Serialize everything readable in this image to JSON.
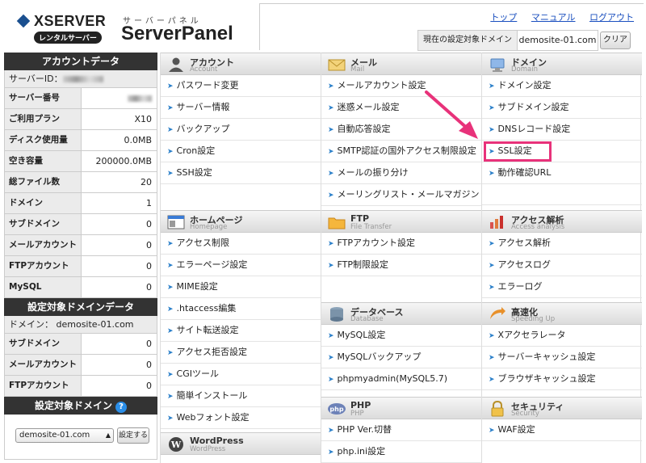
{
  "header": {
    "brand": "XSERVER",
    "tag": "レンタルサーバー",
    "kana": "サーバーパネル",
    "title": "ServerPanel",
    "links": [
      "トップ",
      "マニュアル",
      "ログアウト"
    ],
    "target_label": "現在の設定対象ドメイン",
    "target_value": "demosite-01.com",
    "clear_label": "クリア"
  },
  "sidebar": {
    "account_heading": "アカウントデータ",
    "server_id_label": "サーバーID：",
    "rows": [
      {
        "k": "サーバー番号",
        "v": ""
      },
      {
        "k": "ご利用プラン",
        "v": "X10"
      },
      {
        "k": "ディスク使用量",
        "v": "0.0MB"
      },
      {
        "k": "空き容量",
        "v": "200000.0MB"
      },
      {
        "k": "総ファイル数",
        "v": "20"
      },
      {
        "k": "ドメイン",
        "v": "1"
      },
      {
        "k": "サブドメイン",
        "v": "0"
      },
      {
        "k": "メールアカウント",
        "v": "0"
      },
      {
        "k": "FTPアカウント",
        "v": "0"
      },
      {
        "k": "MySQL",
        "v": "0"
      }
    ],
    "domain_heading": "設定対象ドメインデータ",
    "domain_line": "ドメイン： demosite-01.com",
    "domain_rows": [
      {
        "k": "サブドメイン",
        "v": "0"
      },
      {
        "k": "メールアカウント",
        "v": "0"
      },
      {
        "k": "FTPアカウント",
        "v": "0"
      }
    ],
    "select_heading": "設定対象ドメイン",
    "select_value": "demosite-01.com",
    "set_button": "設定する"
  },
  "sections": {
    "account": {
      "t1": "アカウント",
      "t2": "Account",
      "items": [
        "パスワード変更",
        "サーバー情報",
        "バックアップ",
        "Cron設定",
        "SSH設定"
      ]
    },
    "homepage": {
      "t1": "ホームページ",
      "t2": "Homepage",
      "items": [
        "アクセス制限",
        "エラーページ設定",
        "MIME設定",
        ".htaccess編集",
        "サイト転送設定",
        "アクセス拒否設定",
        "CGIツール",
        "簡単インストール",
        "Webフォント設定"
      ]
    },
    "wordpress": {
      "t1": "WordPress",
      "t2": "WordPress"
    },
    "mail": {
      "t1": "メール",
      "t2": "Mail",
      "items": [
        "メールアカウント設定",
        "迷惑メール設定",
        "自動応答設定",
        "SMTP認証の国外アクセス制限設定",
        "メールの振り分け",
        "メーリングリスト・メールマガジン"
      ]
    },
    "ftp": {
      "t1": "FTP",
      "t2": "File Transfer",
      "items": [
        "FTPアカウント設定",
        "FTP制限設定"
      ]
    },
    "database": {
      "t1": "データベース",
      "t2": "Database",
      "items": [
        "MySQL設定",
        "MySQLバックアップ",
        "phpmyadmin(MySQL5.7)"
      ]
    },
    "php": {
      "t1": "PHP",
      "t2": "PHP",
      "items": [
        "PHP Ver.切替",
        "php.ini設定"
      ]
    },
    "domain": {
      "t1": "ドメイン",
      "t2": "Domain",
      "items": [
        "ドメイン設定",
        "サブドメイン設定",
        "DNSレコード設定",
        "SSL設定",
        "動作確認URL"
      ]
    },
    "analytics": {
      "t1": "アクセス解析",
      "t2": "Access analysis",
      "items": [
        "アクセス解析",
        "アクセスログ",
        "エラーログ"
      ]
    },
    "speed": {
      "t1": "高速化",
      "t2": "Speeding Up",
      "items": [
        "Xアクセラレータ",
        "サーバーキャッシュ設定",
        "ブラウザキャッシュ設定"
      ]
    },
    "security": {
      "t1": "セキュリティ",
      "t2": "Security",
      "items": [
        "WAF設定"
      ]
    }
  },
  "colors": {
    "highlight": "#e8327a",
    "link": "#1a4fbf",
    "arrow_icon": "#2a7fc9"
  }
}
